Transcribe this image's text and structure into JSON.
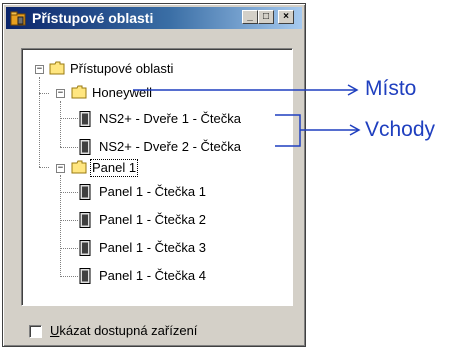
{
  "window": {
    "title": "Přístupové oblasti",
    "buttons": {
      "minimize": "_",
      "maximize": "□",
      "close": "×"
    }
  },
  "tree": {
    "root": {
      "label": "Přístupové oblasti",
      "expander": "−"
    },
    "sites": [
      {
        "label": "Honeywell",
        "expander": "−",
        "readers": [
          "NS2+ - Dveře 1 - Čtečka",
          "NS2+ - Dveře 2 - Čtečka"
        ]
      },
      {
        "label": "Panel 1",
        "expander": "−",
        "readers": [
          "Panel 1 - Čtečka 1",
          "Panel 1 - Čtečka 2",
          "Panel 1 - Čtečka 3",
          "Panel 1 - Čtečka 4"
        ]
      }
    ]
  },
  "footer": {
    "checkbox_label_first": "U",
    "checkbox_label_rest": "kázat dostupná zařízení",
    "checked": false
  },
  "annotations": {
    "site": "Místo",
    "entrances": "Vchody"
  },
  "colors": {
    "annotation": "#1f3fbf",
    "titlebar_start": "#0a246a",
    "titlebar_end": "#a6caf0"
  }
}
